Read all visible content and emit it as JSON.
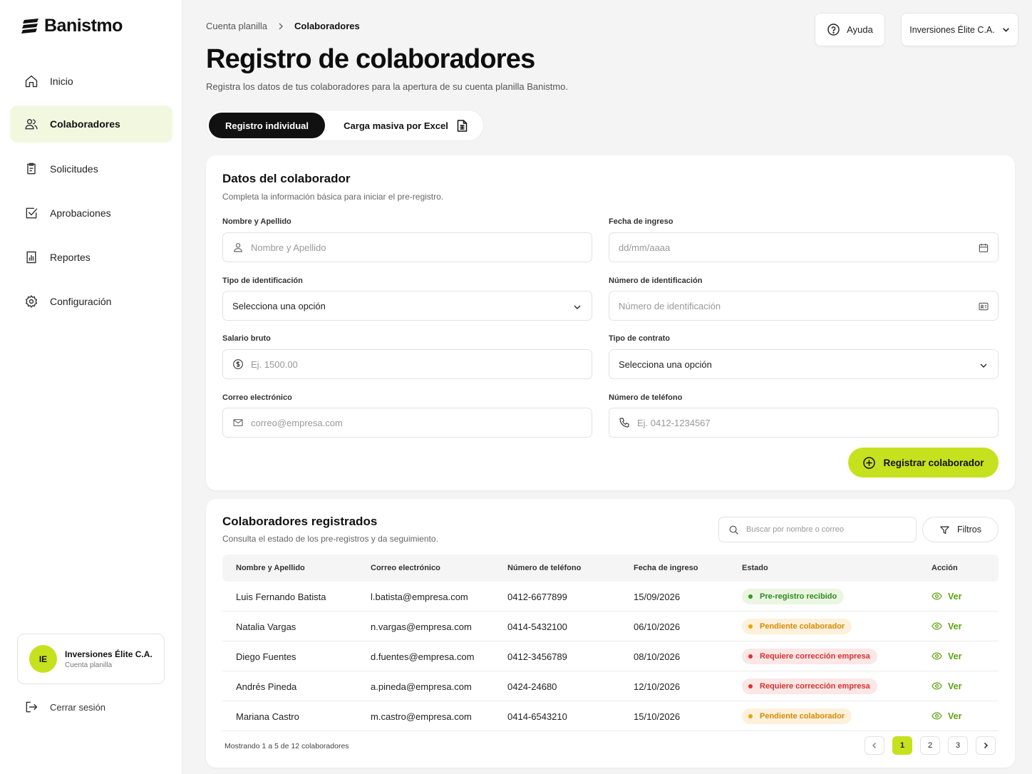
{
  "brand": {
    "name": "Banistmo",
    "accent": "#c6e11e"
  },
  "sidebar": {
    "items": [
      {
        "label": "Inicio",
        "icon": "home-icon"
      },
      {
        "label": "Colaboradores",
        "icon": "users-icon"
      },
      {
        "label": "Solicitudes",
        "icon": "clipboard-icon"
      },
      {
        "label": "Aprobaciones",
        "icon": "checkbox-icon"
      },
      {
        "label": "Reportes",
        "icon": "report-icon"
      },
      {
        "label": "Configuración",
        "icon": "gear-icon"
      }
    ],
    "user": {
      "initials": "IE",
      "name": "Inversiones Élite C.A.",
      "role": "Cuenta planilla"
    },
    "logout_label": "Cerrar sesión"
  },
  "header": {
    "breadcrumb": [
      "Cuenta planilla",
      "Colaboradores"
    ],
    "help_label": "Ayuda",
    "company_label": "Inversiones Élite C.A.",
    "title": "Registro de colaboradores",
    "subtitle": "Registra los datos de tus colaboradores para la apertura de su cuenta planilla Banistmo."
  },
  "tabs": {
    "individual": "Registro individual",
    "bulk": "Carga masiva por Excel"
  },
  "form": {
    "title": "Datos del colaborador",
    "subtitle": "Completa la información básica para iniciar el pre-registro.",
    "name": {
      "label": "Nombre y Apellido",
      "placeholder": "Nombre y Apellido"
    },
    "date": {
      "label": "Fecha de ingreso",
      "placeholder": "dd/mm/aaaa"
    },
    "id_type": {
      "label": "Tipo de identificación",
      "value": "Selecciona una opción"
    },
    "id_number": {
      "label": "Número de identificación",
      "placeholder": "Número de identificación"
    },
    "salary": {
      "label": "Salario bruto",
      "placeholder": "Ej. 1500.00"
    },
    "contract": {
      "label": "Tipo de contrato",
      "value": "Selecciona una opción"
    },
    "email": {
      "label": "Correo electrónico",
      "placeholder": "correo@empresa.com"
    },
    "phone": {
      "label": "Número de teléfono",
      "placeholder": "Ej. 0412-1234567"
    },
    "submit_label": "Registrar colaborador"
  },
  "registered": {
    "title": "Colaboradores registrados",
    "subtitle": "Consulta el estado de los pre-registros y da seguimiento.",
    "search_placeholder": "Buscar por nombre o correo",
    "filters_label": "Filtros",
    "columns": [
      "Nombre y Apellido",
      "Correo electrónico",
      "Número de teléfono",
      "Fecha de ingreso",
      "Estado",
      "Acción"
    ],
    "rows": [
      {
        "name": "Luis Fernando Batista",
        "email": "l.batista@empresa.com",
        "phone": "0412-6677899",
        "date": "15/09/2026",
        "status": "Pre-registro recibido",
        "tone": "green",
        "action": "Ver"
      },
      {
        "name": "Natalia Vargas",
        "email": "n.vargas@empresa.com",
        "phone": "0414-5432100",
        "date": "06/10/2026",
        "status": "Pendiente colaborador",
        "tone": "orange",
        "action": "Ver"
      },
      {
        "name": "Diego Fuentes",
        "email": "d.fuentes@empresa.com",
        "phone": "0412-3456789",
        "date": "08/10/2026",
        "status": "Requiere corrección empresa",
        "tone": "red",
        "action": "Ver"
      },
      {
        "name": "Andrés Pineda",
        "email": "a.pineda@empresa.com",
        "phone": "0424-24680",
        "date": "12/10/2026",
        "status": "Requiere corrección empresa",
        "tone": "red",
        "action": "Ver"
      },
      {
        "name": "Mariana Castro",
        "email": "m.castro@empresa.com",
        "phone": "0414-6543210",
        "date": "15/10/2026",
        "status": "Pendiente colaborador",
        "tone": "orange",
        "action": "Ver"
      }
    ],
    "footer_text": "Mostrando 1 a 5 de 12 colaboradores",
    "pages": [
      "1",
      "2",
      "3"
    ]
  }
}
